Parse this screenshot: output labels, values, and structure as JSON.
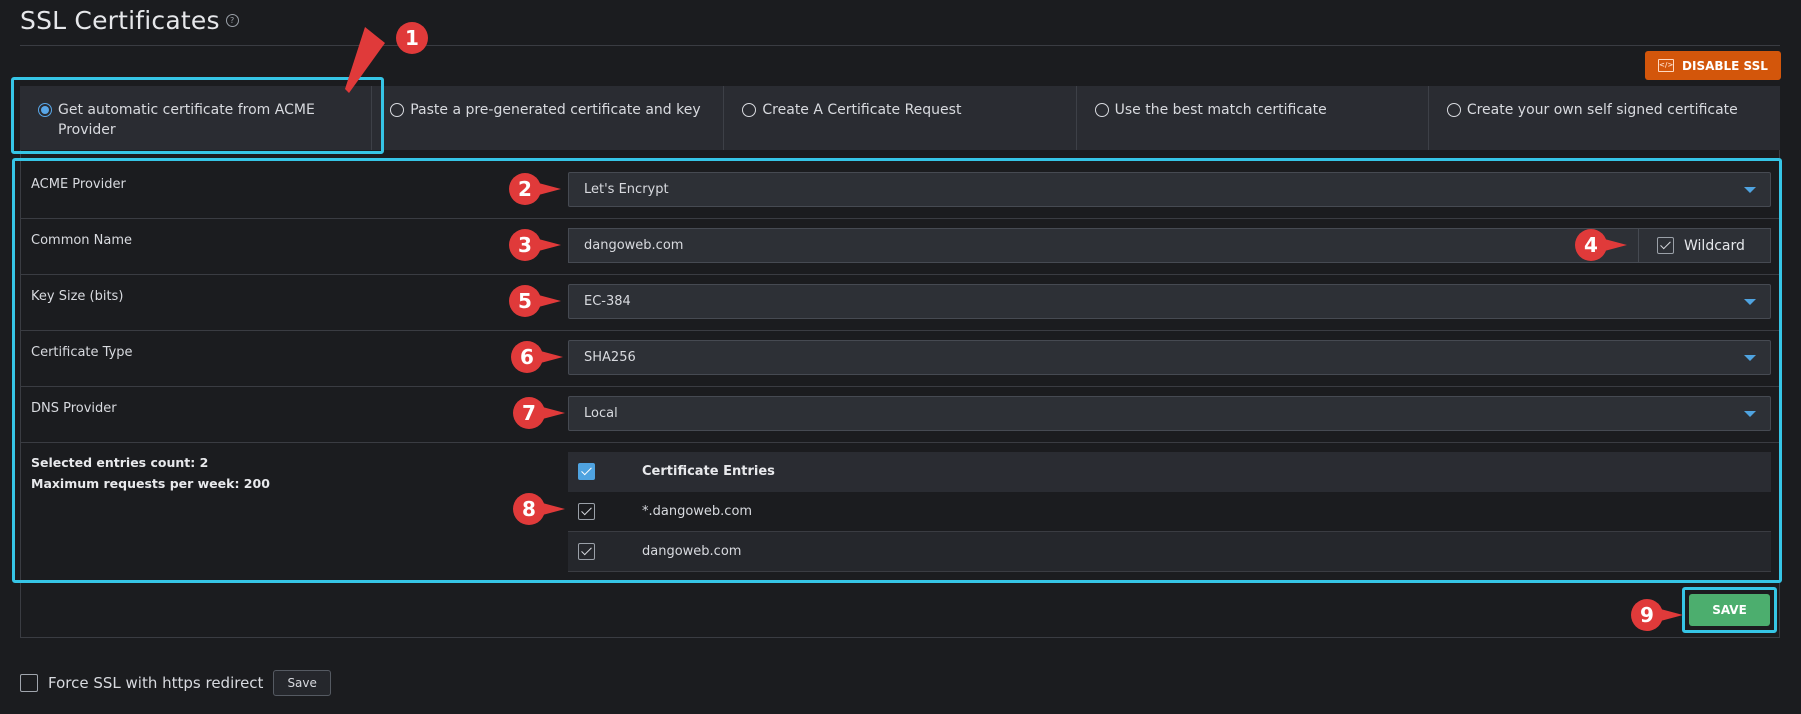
{
  "page": {
    "title": "SSL Certificates",
    "help_glyph": "?"
  },
  "actions": {
    "disable_ssl_label": "DISABLE SSL",
    "disable_ssl_icon": "code-icon",
    "save_label": "SAVE"
  },
  "options": [
    {
      "label": "Get automatic certificate from ACME Provider",
      "selected": true
    },
    {
      "label": "Paste a pre-generated certificate and key",
      "selected": false
    },
    {
      "label": "Create A Certificate Request",
      "selected": false
    },
    {
      "label": "Use the best match certificate",
      "selected": false
    },
    {
      "label": "Create your own self signed certificate",
      "selected": false
    }
  ],
  "form": {
    "acme_provider": {
      "label": "ACME Provider",
      "value": "Let's Encrypt"
    },
    "common_name": {
      "label": "Common Name",
      "value": "dangoweb.com",
      "wildcard_label": "Wildcard",
      "wildcard_checked": true
    },
    "key_size": {
      "label": "Key Size (bits)",
      "value": "EC-384"
    },
    "certificate_type": {
      "label": "Certificate Type",
      "value": "SHA256"
    },
    "dns_provider": {
      "label": "DNS Provider",
      "value": "Local"
    }
  },
  "stats": {
    "selected_count": "Selected entries count: 2",
    "max_requests": "Maximum requests per week: 200"
  },
  "entries": {
    "header": "Certificate Entries",
    "rows": [
      {
        "name": "*.dangoweb.com",
        "checked": true
      },
      {
        "name": "dangoweb.com",
        "checked": true
      }
    ]
  },
  "force_ssl": {
    "label": "Force SSL with https redirect",
    "save_label": "Save",
    "checked": false
  },
  "annotations": [
    "1",
    "2",
    "3",
    "4",
    "5",
    "6",
    "7",
    "8",
    "9"
  ],
  "colors": {
    "accent": "#36c5e6",
    "danger": "#d3560b",
    "success": "#4cae6e",
    "marker": "#e03a3a",
    "link": "#4fa3e0"
  }
}
